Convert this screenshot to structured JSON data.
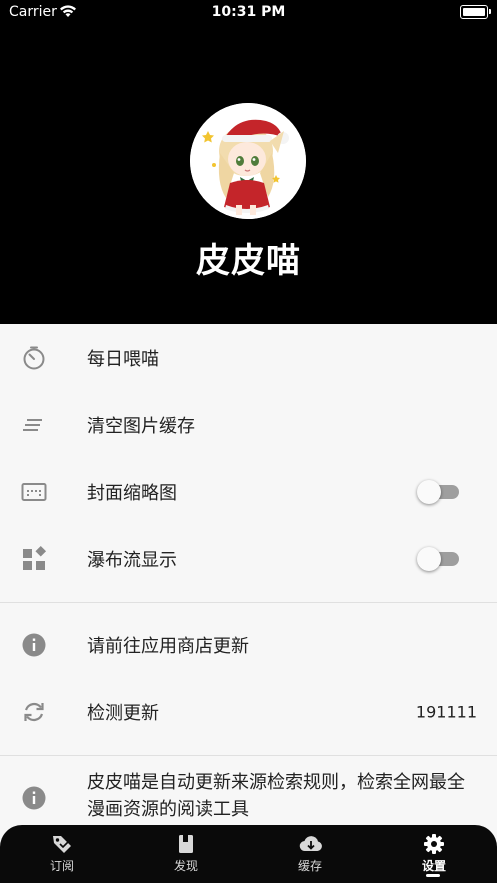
{
  "status_bar": {
    "carrier": "Carrier",
    "time": "10:31 PM"
  },
  "profile": {
    "name": "皮皮喵"
  },
  "menu": {
    "daily_feed": "每日喂喵",
    "clear_cache": "清空图片缓存",
    "cover_thumbnail": {
      "label": "封面缩略图",
      "enabled": false
    },
    "waterfall": {
      "label": "瀑布流显示",
      "enabled": false
    },
    "app_store_update": "请前往应用商店更新",
    "check_update": {
      "label": "检测更新",
      "value": "191111"
    },
    "about": "皮皮喵是自动更新来源检索规则，检索全网最全漫画资源的阅读工具"
  },
  "tabs": [
    {
      "label": "订阅",
      "icon": "tag-icon"
    },
    {
      "label": "发现",
      "icon": "book-icon"
    },
    {
      "label": "缓存",
      "icon": "cloud-download-icon"
    },
    {
      "label": "设置",
      "icon": "gear-icon",
      "active": true
    }
  ],
  "colors": {
    "header_bg": "#000000",
    "list_bg": "#f7f7f7",
    "icon_gray": "#8a8a8a",
    "toggle_off": "#9e9e9e"
  }
}
